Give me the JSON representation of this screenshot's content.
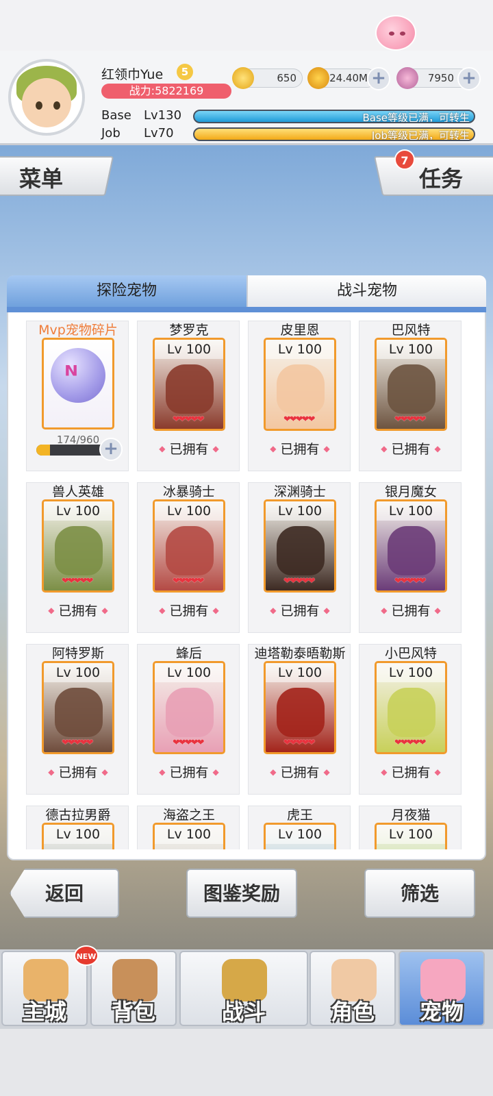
{
  "player": {
    "name": "红领巾Yue",
    "vip_level": "5",
    "power": "战力:5822169"
  },
  "currencies": [
    {
      "icon": "zeny-coin-icon",
      "value": "650"
    },
    {
      "icon": "gold-bag-icon",
      "value": "24.40M"
    },
    {
      "icon": "pink-gem-icon",
      "value": "7950"
    }
  ],
  "levels": {
    "base_label": "Base",
    "base_value": "Lv130",
    "base_bar_text": "Base等级已满，可转生",
    "job_label": "Job",
    "job_value": "Lv70",
    "job_bar_text": "Job等级已满，可转生"
  },
  "buttons": {
    "menu": "菜单",
    "task": "任务",
    "task_badge": "7",
    "back": "返回",
    "album_reward": "图鉴奖励",
    "filter": "筛选"
  },
  "tabs": [
    "探险宠物",
    "战斗宠物"
  ],
  "mvp_shard": {
    "name": "Mvp宠物碎片",
    "progress_text": "174/960",
    "progress_fraction": 0.18
  },
  "pets": [
    {
      "name": "梦罗克",
      "level": "Lv 100",
      "status": "已拥有",
      "color": "#8a3b2c"
    },
    {
      "name": "皮里恩",
      "level": "Lv 100",
      "status": "已拥有",
      "color": "#f3c7a1"
    },
    {
      "name": "巴风特",
      "level": "Lv 100",
      "status": "已拥有",
      "color": "#6d5440"
    },
    {
      "name": "兽人英雄",
      "level": "Lv 100",
      "status": "已拥有",
      "color": "#7c8f46"
    },
    {
      "name": "冰暴骑士",
      "level": "Lv 100",
      "status": "已拥有",
      "color": "#b44a44"
    },
    {
      "name": "深渊骑士",
      "level": "Lv 100",
      "status": "已拥有",
      "color": "#3d2a22"
    },
    {
      "name": "银月魔女",
      "level": "Lv 100",
      "status": "已拥有",
      "color": "#6b3c78"
    },
    {
      "name": "阿特罗斯",
      "level": "Lv 100",
      "status": "已拥有",
      "color": "#6f4c3c"
    },
    {
      "name": "蜂后",
      "level": "Lv 100",
      "status": "已拥有",
      "color": "#e8a0b5"
    },
    {
      "name": "迪塔勒泰晤勒斯",
      "level": "Lv 100",
      "status": "已拥有",
      "color": "#a3241b"
    },
    {
      "name": "小巴风特",
      "level": "Lv 100",
      "status": "已拥有",
      "color": "#c8d05a"
    },
    {
      "name": "德古拉男爵",
      "level": "Lv 100",
      "status": "",
      "color": "#9fb0b6"
    },
    {
      "name": "海盗之王",
      "level": "Lv 100",
      "status": "",
      "color": "#c9c9c9"
    },
    {
      "name": "虎王",
      "level": "Lv 100",
      "status": "",
      "color": "#8fc3e6"
    },
    {
      "name": "月夜猫",
      "level": "Lv 100",
      "status": "",
      "color": "#a5d66a"
    }
  ],
  "hearts": "❤❤❤❤❤",
  "nav": [
    {
      "label": "主城",
      "icon": "castle-icon",
      "color": "#e9b36a"
    },
    {
      "label": "背包",
      "icon": "backpack-icon",
      "color": "#c8905a"
    },
    {
      "label": "战斗",
      "icon": "battle-shield-icon",
      "color": "#d6a848"
    },
    {
      "label": "角色",
      "icon": "character-icon",
      "color": "#f0c9a4"
    },
    {
      "label": "宠物",
      "icon": "pet-poring-icon",
      "color": "#f6a7c0"
    }
  ],
  "new_badge": "NEW"
}
